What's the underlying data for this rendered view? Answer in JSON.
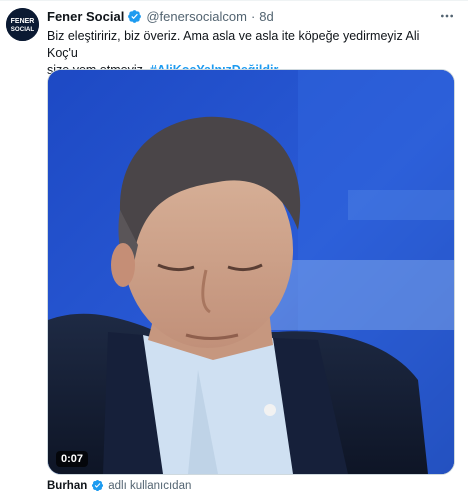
{
  "tweet": {
    "avatar_text_line1": "FENER",
    "avatar_text_line2": "SOCIAL",
    "display_name": "Fener Social",
    "handle": "@fenersocialcom",
    "separator": "·",
    "time": "8d",
    "text_line1": "Biz eleştiririz, biz överiz. Ama asla ve asla ite köpeğe yedirmeyiz Ali Koç'u",
    "text_line2": "size yem etmeyiz.",
    "hashtag": "#AliKoçYalnızDeğildir"
  },
  "media": {
    "duration": "0:07"
  },
  "attribution": {
    "name": "Burhan",
    "note": "adlı kullanıcıdan"
  },
  "colors": {
    "accent": "#1d9bf0",
    "text": "#0f1419",
    "secondary": "#536471",
    "video_background": "#1b3b9a"
  },
  "icons": {
    "verified": "verified-badge-icon",
    "more": "more-dots-icon"
  }
}
